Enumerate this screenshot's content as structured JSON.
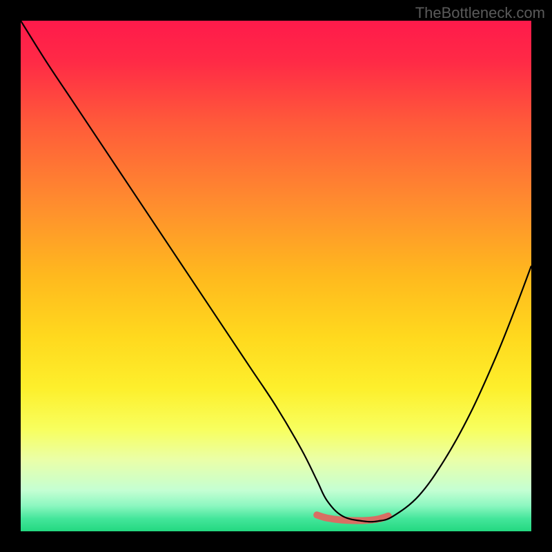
{
  "watermark": "TheBottleneck.com",
  "chart_data": {
    "type": "line",
    "title": "",
    "xlabel": "",
    "ylabel": "",
    "xlim": [
      0,
      100
    ],
    "ylim": [
      0,
      100
    ],
    "gradient_stops": [
      {
        "offset": 0.0,
        "color": "#ff1a4b"
      },
      {
        "offset": 0.08,
        "color": "#ff2a46"
      },
      {
        "offset": 0.2,
        "color": "#ff5a3a"
      },
      {
        "offset": 0.35,
        "color": "#ff8a2f"
      },
      {
        "offset": 0.5,
        "color": "#ffb91e"
      },
      {
        "offset": 0.62,
        "color": "#ffd91e"
      },
      {
        "offset": 0.72,
        "color": "#fdef2c"
      },
      {
        "offset": 0.8,
        "color": "#f8ff5e"
      },
      {
        "offset": 0.86,
        "color": "#eaffa8"
      },
      {
        "offset": 0.92,
        "color": "#c4ffd3"
      },
      {
        "offset": 0.95,
        "color": "#8cf7c0"
      },
      {
        "offset": 0.975,
        "color": "#44e69b"
      },
      {
        "offset": 1.0,
        "color": "#23d880"
      }
    ],
    "series": [
      {
        "name": "bottleneck-curve",
        "x": [
          0,
          5,
          10,
          15,
          20,
          25,
          30,
          35,
          40,
          45,
          50,
          55,
          58,
          60,
          63,
          67,
          70,
          73,
          78,
          83,
          88,
          93,
          97,
          100
        ],
        "y": [
          100,
          92,
          84.5,
          77,
          69.5,
          62,
          54.5,
          47,
          39.5,
          32,
          24.5,
          16,
          10,
          6,
          3,
          2,
          2,
          3,
          7,
          14,
          23,
          34,
          44,
          52
        ]
      }
    ],
    "highlight_segment": {
      "name": "optimal-range",
      "x": [
        58,
        60,
        63,
        67,
        70,
        72
      ],
      "y": [
        3.2,
        2.6,
        2.2,
        2.1,
        2.4,
        3.0
      ]
    }
  }
}
